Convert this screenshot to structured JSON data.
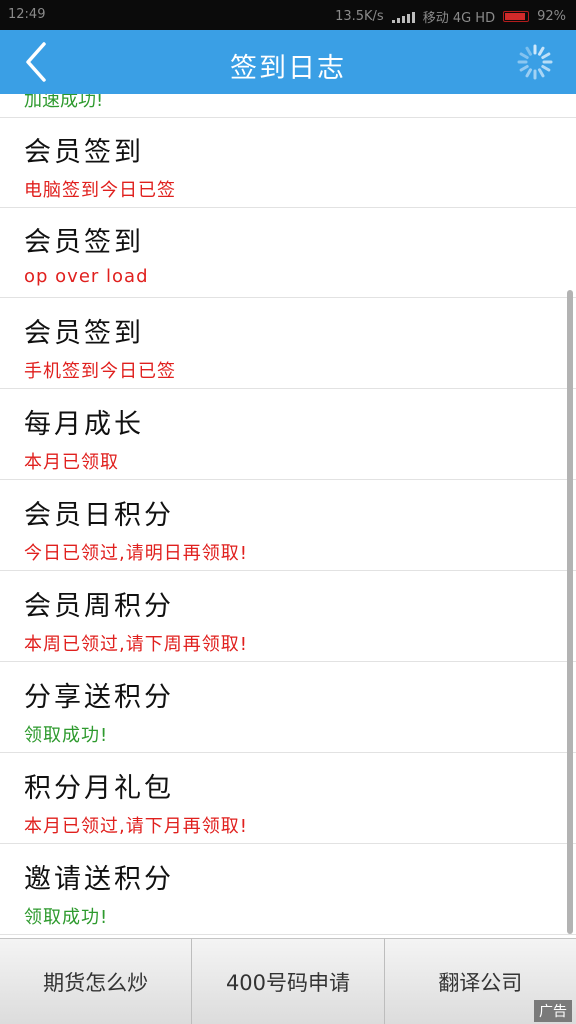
{
  "status_bar": {
    "time": "12:49",
    "speed": "13.5K/s",
    "carrier": "移动 4G HD",
    "battery": "92%",
    "battery_level": 0.92,
    "signal_icon": "signal-bars-icon",
    "battery_color": "#d12a2a"
  },
  "header": {
    "title": "签到日志",
    "back_icon": "back-chevron-icon",
    "loading_icon": "loading-spinner-icon",
    "color": "#3a9fe5"
  },
  "partial_item": {
    "status": "加速成功!"
  },
  "items": [
    {
      "title": "会员签到",
      "status": "电脑签到今日已签"
    },
    {
      "title": "会员签到",
      "status": "op over load"
    },
    {
      "title": "会员签到",
      "status": "手机签到今日已签"
    },
    {
      "title": "每月成长",
      "status": "本月已领取"
    },
    {
      "title": "会员日积分",
      "status": "今日已领过,请明日再领取!"
    },
    {
      "title": "会员周积分",
      "status": "本周已领过,请下周再领取!"
    },
    {
      "title": "分享送积分",
      "status": "领取成功!"
    },
    {
      "title": "积分月礼包",
      "status": "本月已领过,请下月再领取!"
    },
    {
      "title": "邀请送积分",
      "status": "领取成功!"
    }
  ],
  "status_colors": {
    "error": "#e0201e",
    "success": "#2e9a2e"
  },
  "ad_bar": {
    "buttons": [
      "期货怎么炒",
      "400号码申请",
      "翻译公司"
    ],
    "badge": "广告"
  }
}
